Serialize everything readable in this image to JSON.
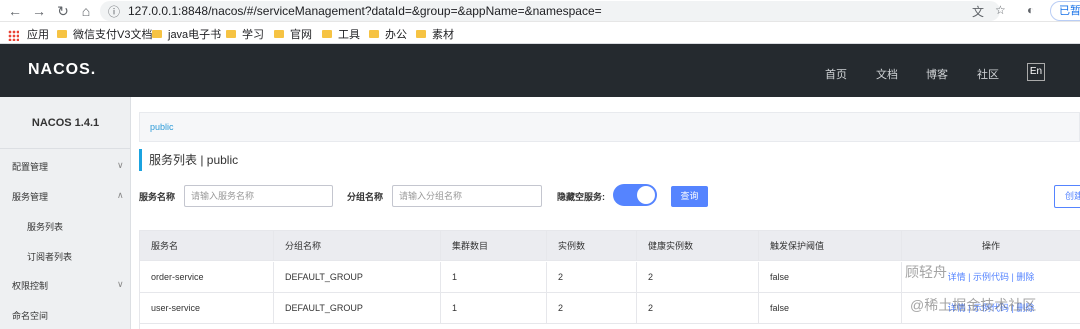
{
  "browser": {
    "url": "127.0.0.1:8848/nacos/#/serviceManagement?dataId=&group=&appName=&namespace=",
    "signin_label": "已暂",
    "back": "←",
    "forward": "→",
    "reload": "↻",
    "home": "⌂"
  },
  "bookmarks": {
    "apps": "应用",
    "items": [
      "微信支付V3文档",
      "java电子书",
      "学习",
      "官网",
      "工具",
      "办公",
      "素材"
    ]
  },
  "header": {
    "logo": "NACOS.",
    "nav": [
      "首页",
      "文档",
      "博客",
      "社区"
    ],
    "lang": "En"
  },
  "sidebar": {
    "title": "NACOS 1.4.1",
    "items": [
      {
        "label": "配置管理"
      },
      {
        "label": "服务管理"
      },
      {
        "label": "服务列表"
      },
      {
        "label": "订阅者列表"
      },
      {
        "label": "权限控制"
      },
      {
        "label": "命名空间"
      }
    ]
  },
  "main": {
    "breadcrumb": "public",
    "title": "服务列表  |  public",
    "filters": {
      "service_label": "服务名称",
      "service_placeholder": "请输入服务名称",
      "group_label": "分组名称",
      "group_placeholder": "请输入分组名称",
      "hide_empty_label": "隐藏空服务:",
      "hide_empty_on": true,
      "query_label": "查询",
      "create_label": "创建"
    },
    "table": {
      "headers": [
        "服务名",
        "分组名称",
        "集群数目",
        "实例数",
        "健康实例数",
        "触发保护阈值",
        "操作"
      ],
      "rows": [
        [
          "order-service",
          "DEFAULT_GROUP",
          "1",
          "2",
          "2",
          "false",
          "详情 | 示例代码 | 删除"
        ],
        [
          "user-service",
          "DEFAULT_GROUP",
          "1",
          "2",
          "2",
          "false",
          "详情 | 示例代码 | 删除"
        ]
      ]
    }
  },
  "watermark": {
    "line1": "顾轻舟",
    "line2": "@稀土掘金技术社区"
  },
  "colors": {
    "header_bg": "#252a2f",
    "accent": "#5584ff",
    "title_bar": "#1ba3e0"
  }
}
